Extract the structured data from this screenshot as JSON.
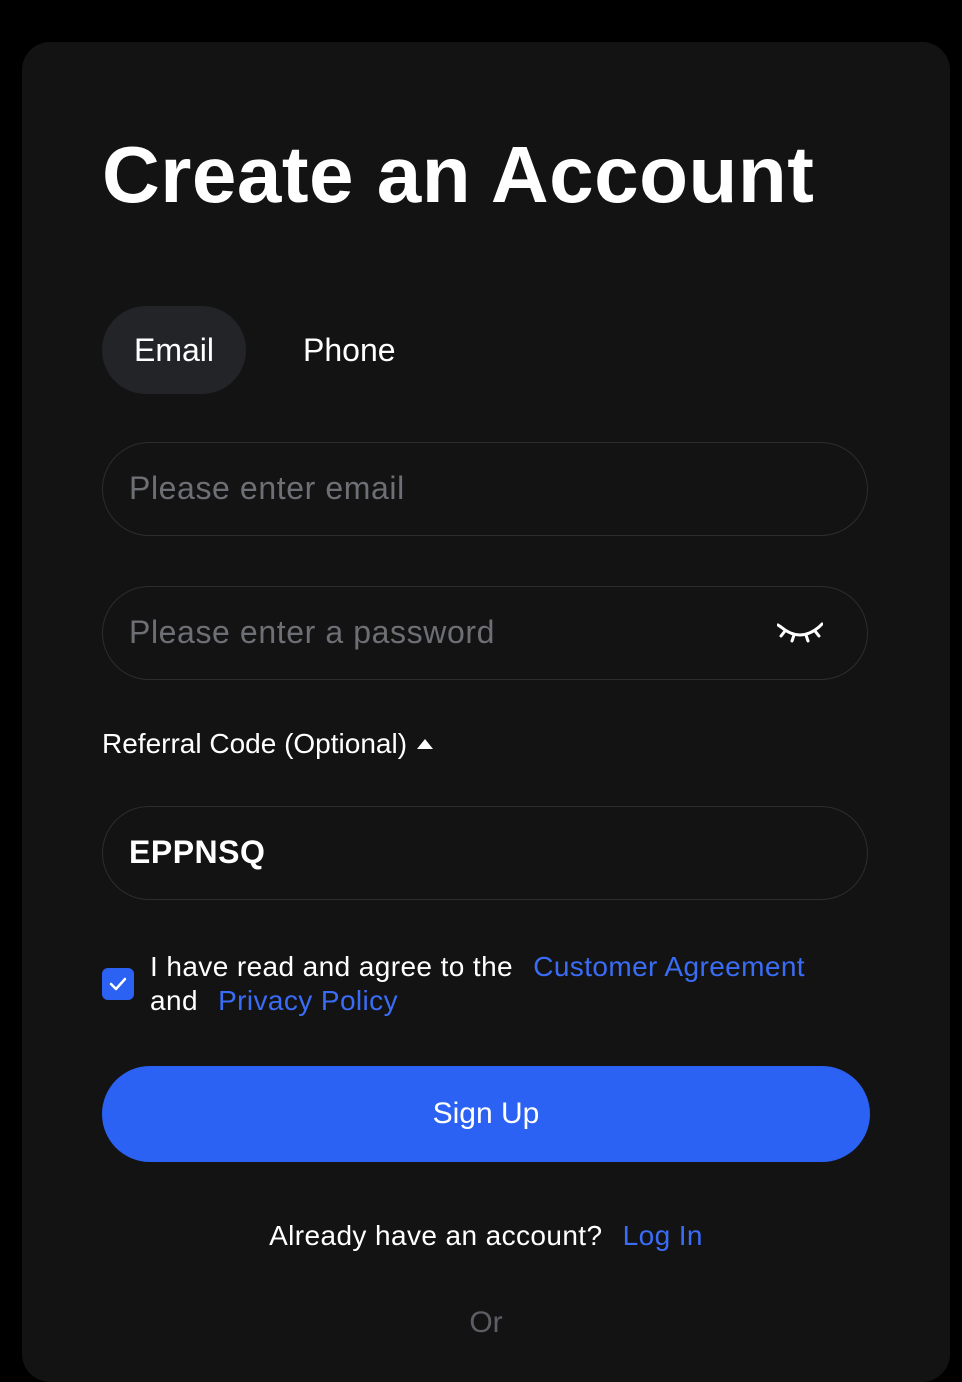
{
  "title": "Create an Account",
  "tabs": {
    "email": "Email",
    "phone": "Phone",
    "active": "Email"
  },
  "email_field": {
    "value": "",
    "placeholder": "Please enter email"
  },
  "password_field": {
    "value": "",
    "placeholder": "Please enter a password",
    "visibility_icon": "eye-closed-icon"
  },
  "referral": {
    "toggle_label": "Referral Code (Optional)",
    "toggle_icon": "caret-up-icon",
    "value": "EPPNSQ"
  },
  "agreement": {
    "checked": true,
    "text_before": "I have read and agree to the",
    "customer_agreement": "Customer Agreement",
    "text_and": "and",
    "privacy_policy": "Privacy Policy"
  },
  "signup_button": "Sign Up",
  "login_prompt": {
    "text": "Already have an account?",
    "link": "Log In"
  },
  "divider_text": "Or",
  "colors": {
    "background": "#000000",
    "card": "#131314",
    "accent": "#2b62f4",
    "link": "#3a6cf5",
    "placeholder": "#6e6f74",
    "active_tab": "#232428"
  }
}
